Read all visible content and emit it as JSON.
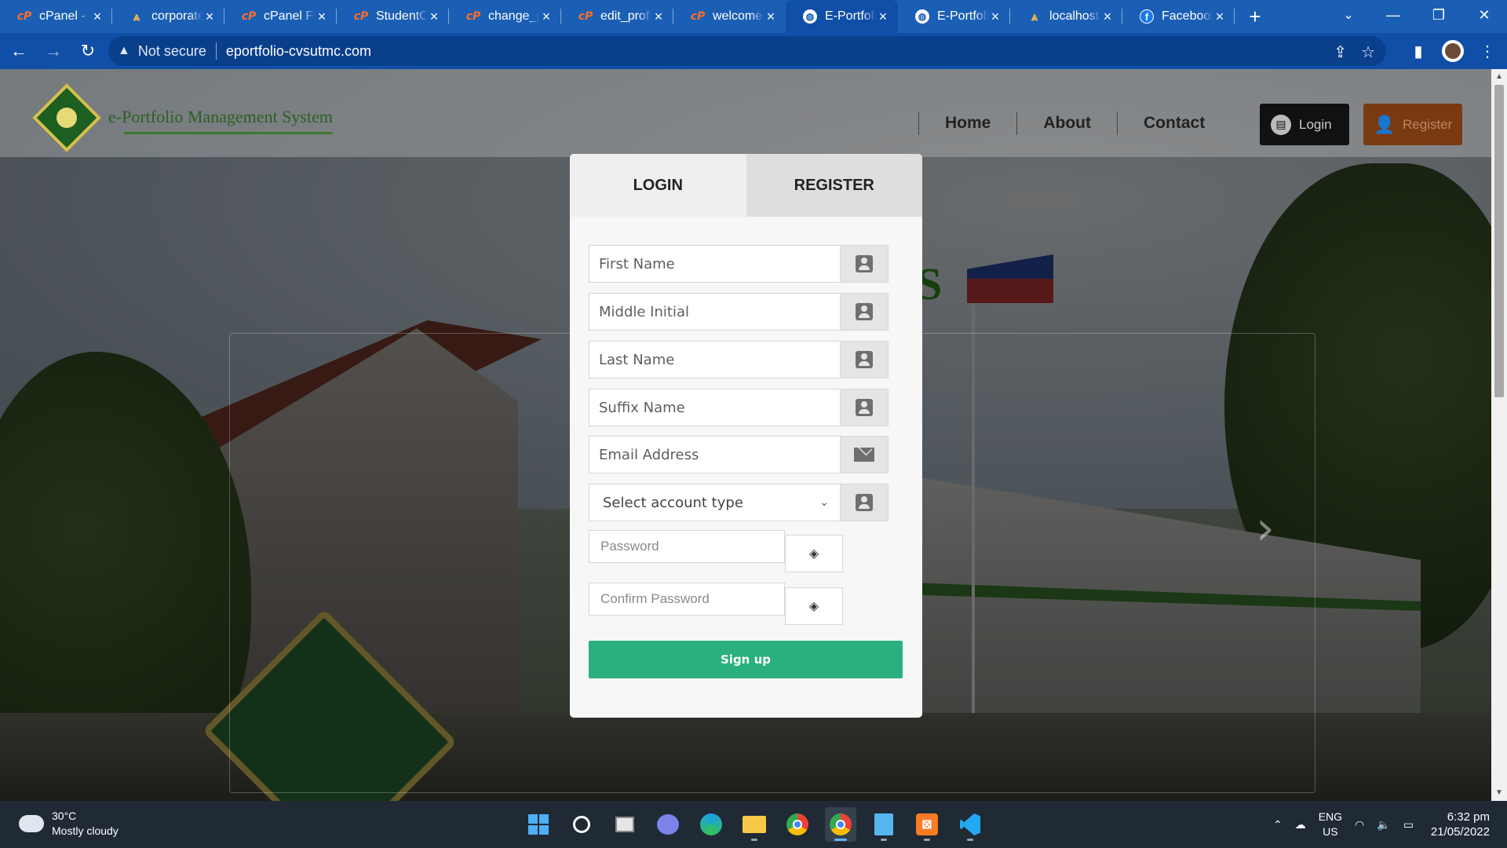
{
  "browser": {
    "tabs": [
      {
        "title": "cPanel - Main",
        "favicon": "cpanel-icon",
        "active": false
      },
      {
        "title": "corporate",
        "favicon": "xampp-icon",
        "active": false
      },
      {
        "title": "cPanel File Manager",
        "favicon": "cpanel-icon",
        "active": false
      },
      {
        "title": "StudentC",
        "favicon": "cpanel-icon",
        "active": false
      },
      {
        "title": "change_p",
        "favicon": "cpanel-icon",
        "active": false
      },
      {
        "title": "edit_profi",
        "favicon": "cpanel-icon",
        "active": false
      },
      {
        "title": "welcome",
        "favicon": "cpanel-icon",
        "active": false
      },
      {
        "title": "E-Portfolio",
        "favicon": "globe-icon",
        "active": true
      },
      {
        "title": "E-Portfolio",
        "favicon": "globe-icon",
        "active": false
      },
      {
        "title": "localhost",
        "favicon": "xampp-icon",
        "active": false
      },
      {
        "title": "Facebook",
        "favicon": "facebook-icon",
        "active": false
      }
    ],
    "new_tab": "+",
    "security_label": "Not secure",
    "url": "eportfolio-cvsutmc.com"
  },
  "site": {
    "title": "e-Portfolio Management System",
    "nav": [
      "Home",
      "About",
      "Contact"
    ],
    "login_button": "Login",
    "register_button": "Register",
    "background_word": "S"
  },
  "modal": {
    "tabs": {
      "login": "LOGIN",
      "register": "REGISTER"
    },
    "fields": {
      "first_name": {
        "placeholder": "First Name",
        "icon": "user-icon"
      },
      "middle_initial": {
        "placeholder": "Middle Initial",
        "icon": "user-icon"
      },
      "last_name": {
        "placeholder": "Last Name",
        "icon": "user-icon"
      },
      "suffix_name": {
        "placeholder": "Suffix Name",
        "icon": "user-icon"
      },
      "email": {
        "placeholder": "Email Address",
        "icon": "envelope-icon"
      },
      "account_type": {
        "value": "Select account type",
        "icon": "user-icon"
      },
      "password": {
        "placeholder": "Password",
        "icon": "eye-slash-icon"
      },
      "confirm_password": {
        "placeholder": "Confirm Password",
        "icon": "eye-slash-icon"
      }
    },
    "submit_label": "Sign up"
  },
  "taskbar": {
    "weather": {
      "temp": "30°C",
      "condition": "Mostly cloudy"
    },
    "language": {
      "line1": "ENG",
      "line2": "US"
    },
    "clock": {
      "time": "6:32 pm",
      "date": "21/05/2022"
    }
  },
  "colors": {
    "browser_chrome": "#1a5fb4",
    "signup_button": "#29b07e",
    "login_button": "#111111",
    "register_button": "#7a3a10"
  }
}
